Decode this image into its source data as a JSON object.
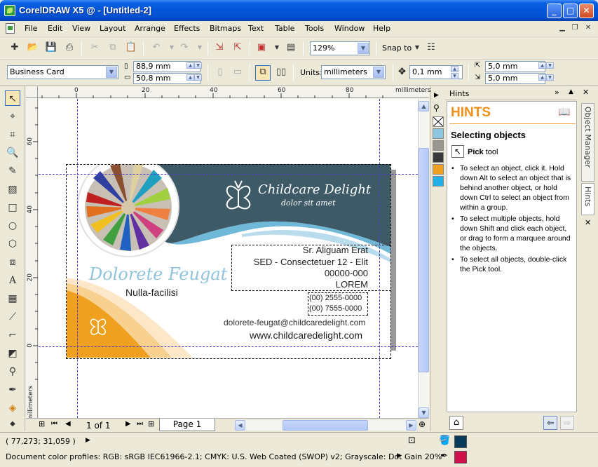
{
  "window": {
    "title": "CorelDRAW X5 @ - [Untitled-2]",
    "min": "_",
    "max": "□",
    "close": "✕"
  },
  "menu": [
    "File",
    "Edit",
    "View",
    "Layout",
    "Arrange",
    "Effects",
    "Bitmaps",
    "Text",
    "Table",
    "Tools",
    "Window",
    "Help"
  ],
  "toolbar": {
    "zoom": "129%",
    "snap_to": "Snap to"
  },
  "propbar": {
    "page_preset": "Business Card",
    "width": "88,9 mm",
    "height": "50,8 mm",
    "units_label": "Units:",
    "units": "millimeters",
    "nudge": "0,1 mm",
    "dup_x": "5,0 mm",
    "dup_y": "5,0 mm"
  },
  "ruler": {
    "top_labels": [
      "0",
      "20",
      "40",
      "60",
      "80"
    ],
    "top_unit": "millimeters",
    "left_labels": [
      "60",
      "40",
      "20",
      "0"
    ],
    "left_unit": "millimeters"
  },
  "card": {
    "brand": "Childcare Delight",
    "tagline": "dolor sit amet",
    "name": "Dolorete Feugat",
    "title": "Nulla-facilisi",
    "address": [
      "Sr. Aliguam Erat",
      "SED - Consectetuer 12 - Elit",
      "00000-000",
      "LOREM"
    ],
    "phones": [
      "(00) 2555-0000",
      "(00) 7555-0000"
    ],
    "email": "dolorete-feugat@childcaredelight.com",
    "web": "www.childcaredelight.com"
  },
  "pages": {
    "counter": "1 of 1",
    "tab": "Page 1"
  },
  "hints": {
    "panel_title": "Hints",
    "big_title": "HINTS",
    "section": "Selecting objects",
    "tool_name": "Pick",
    "tool_suffix": " tool",
    "items": [
      "To select an object, click it. Hold down Alt to select an object that is behind another object, or hold down Ctrl to select an object from within a group.",
      "To select multiple objects, hold down Shift and click each object, or drag to form a marquee around the objects.",
      "To select all objects, double-click the Pick tool."
    ],
    "tabs": [
      "Object Manager",
      "Hints"
    ]
  },
  "status": {
    "coords": "( 77,273; 31,059 )",
    "profiles": "Document color profiles: RGB: sRGB IEC61966-2.1; CMYK: U.S. Web Coated (SWOP) v2; Grayscale: Dot Gain 20%"
  },
  "colors": {
    "card_teal": "#3d5a66",
    "card_blue": "#6fb8d8",
    "card_orange": "#f0a020",
    "fill_color": "#0a3a5a",
    "outline_color": "#d0104a"
  }
}
